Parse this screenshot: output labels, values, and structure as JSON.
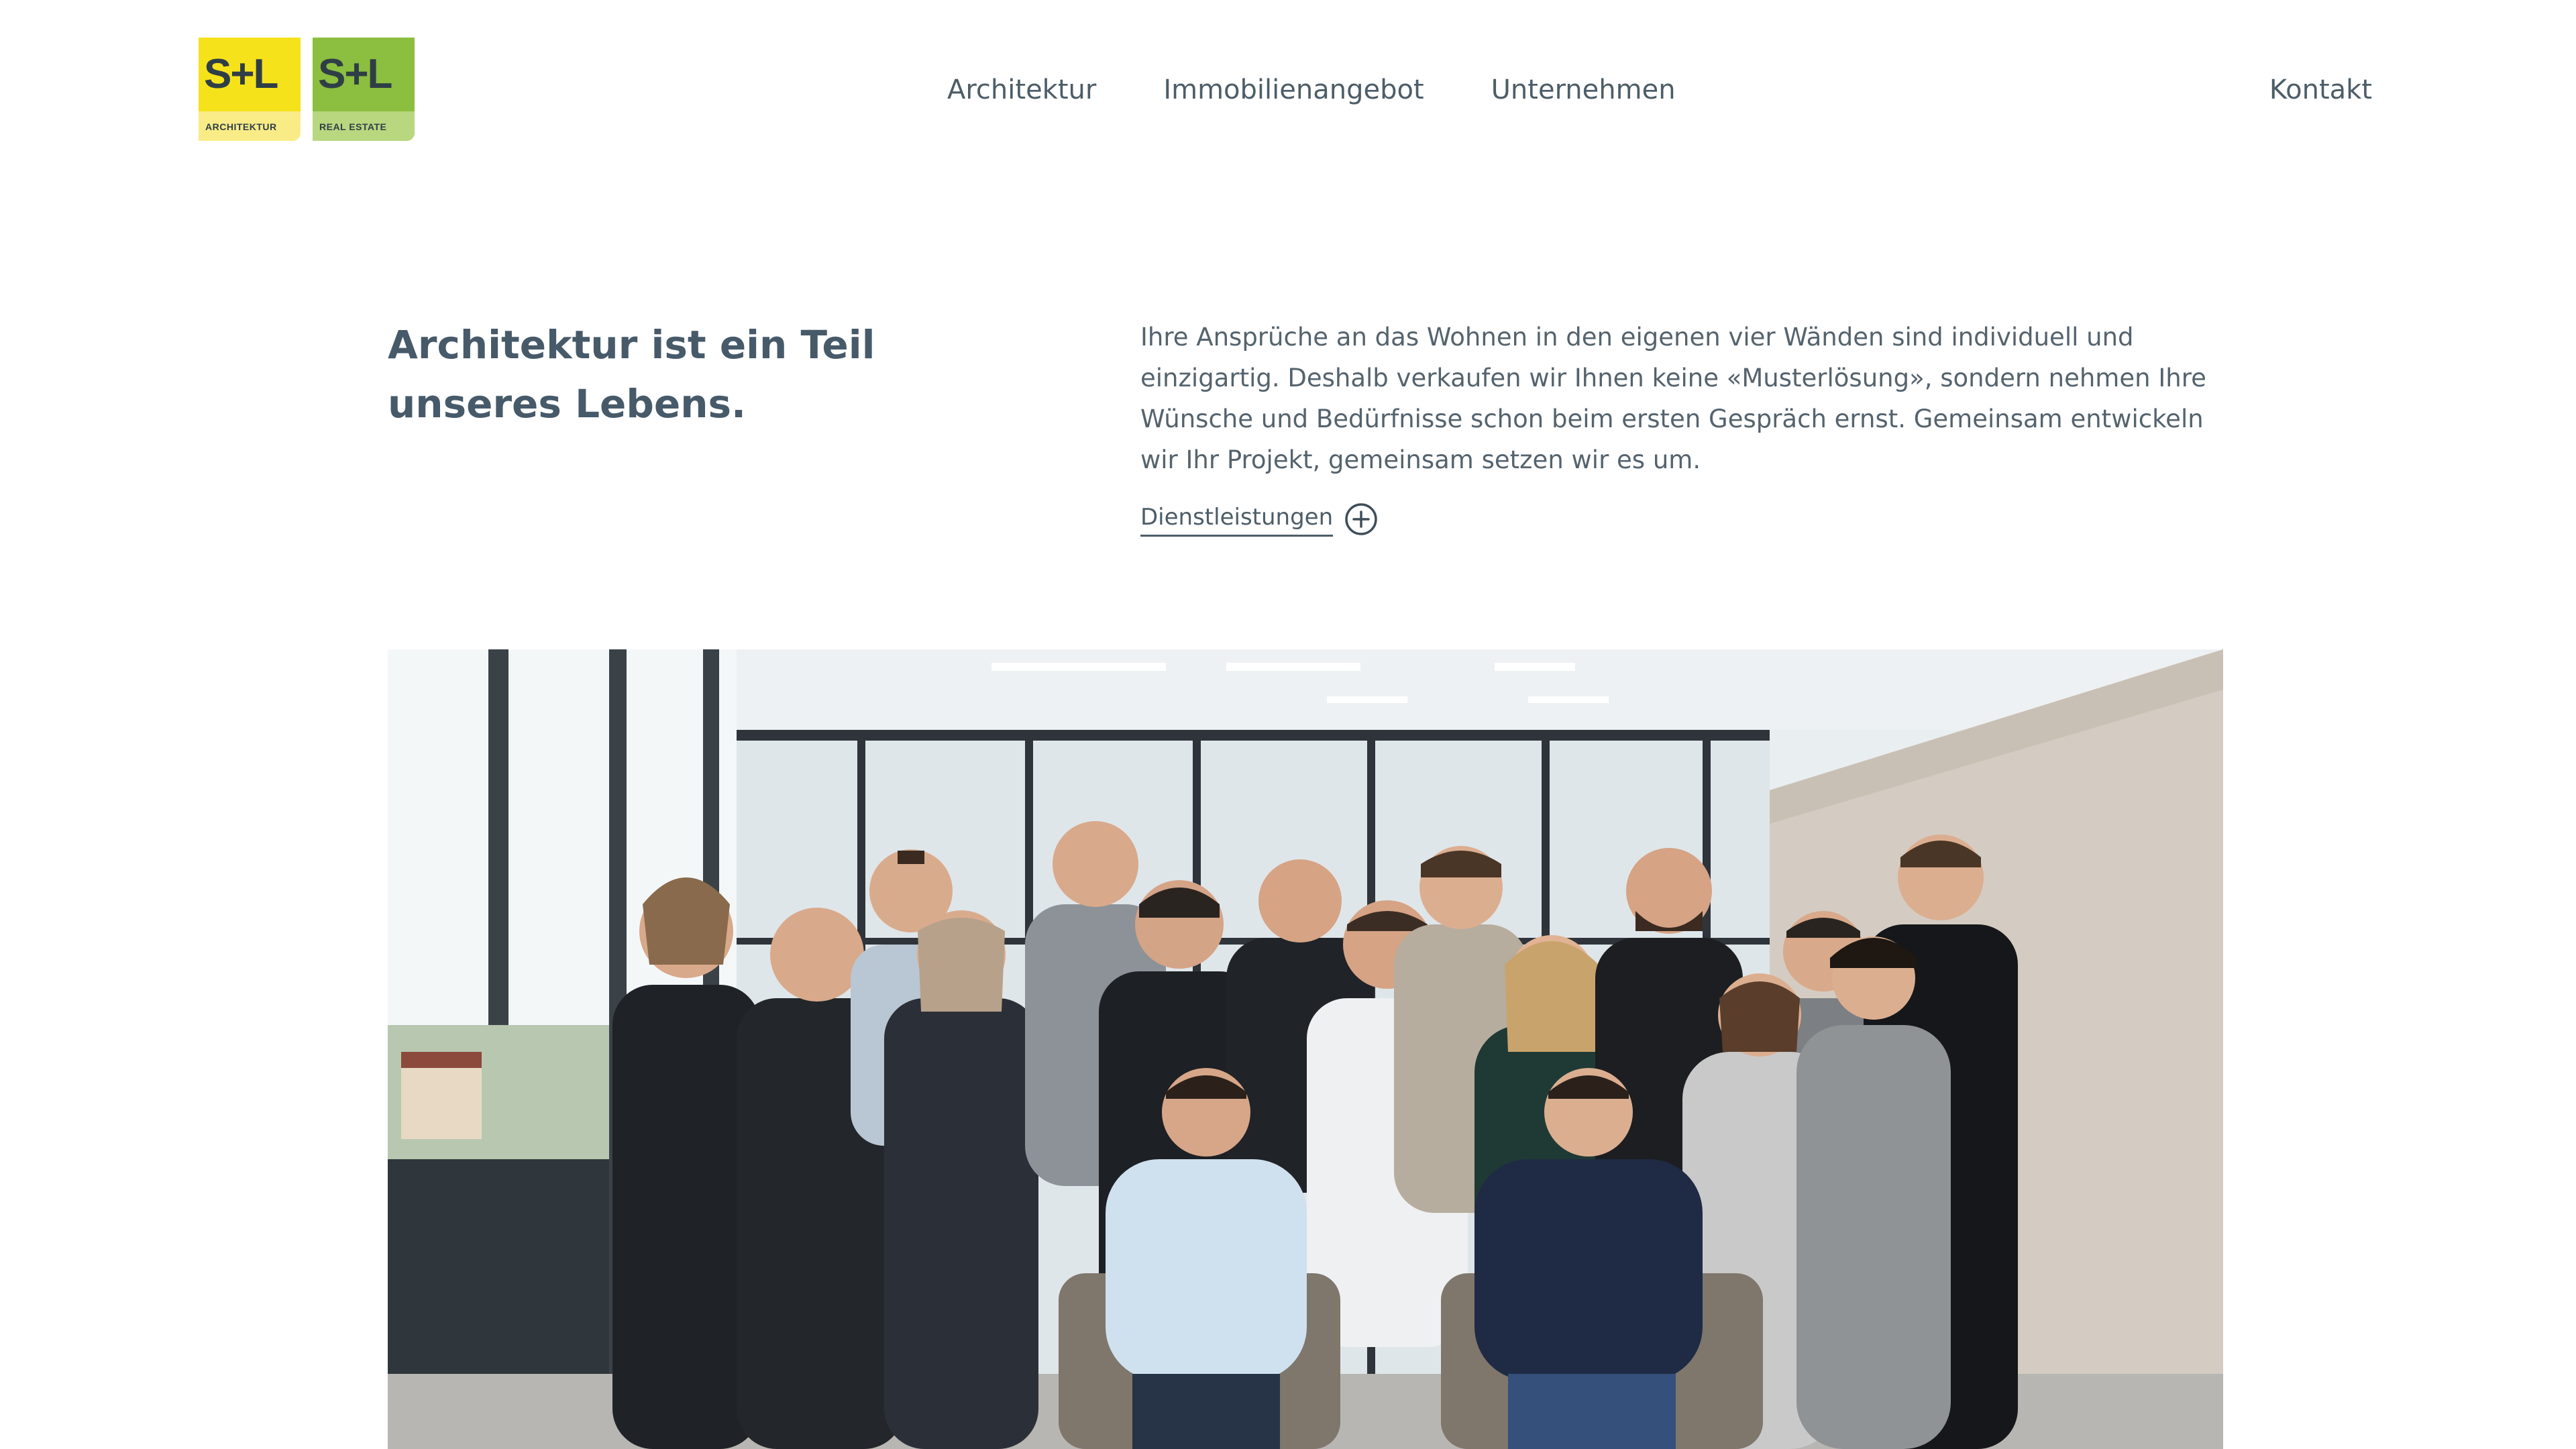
{
  "brand": {
    "logos": [
      {
        "mark": "S+L",
        "subtitle": "ARCHITEKTUR",
        "color": "#f5e21b"
      },
      {
        "mark": "S+L",
        "subtitle": "REAL ESTATE",
        "color": "#8cbe3f"
      }
    ]
  },
  "nav": {
    "items": [
      {
        "label": "Architektur"
      },
      {
        "label": "Immobilienangebot"
      },
      {
        "label": "Unternehmen"
      }
    ],
    "contact": "Kontakt"
  },
  "intro": {
    "headline": "Architektur ist ein Teil unseres Lebens.",
    "body": "Ihre Ansprüche an das Wohnen in den eigenen vier Wänden sind individuell und einzigartig. Deshalb verkaufen wir Ihnen keine «Musterlösung», sondern nehmen Ihre Wünsche und Bedürfnisse schon beim ersten Gespräch ernst. Gemeinsam entwickeln wir Ihr Projekt, gemeinsam setzen wir es um.",
    "link_label": "Dienstleistungen",
    "link_icon": "plus-circle-icon"
  },
  "colors": {
    "text": "#4d5d68",
    "headline": "#475a6a",
    "logo_yellow": "#f5e21b",
    "logo_green": "#8cbe3f"
  }
}
